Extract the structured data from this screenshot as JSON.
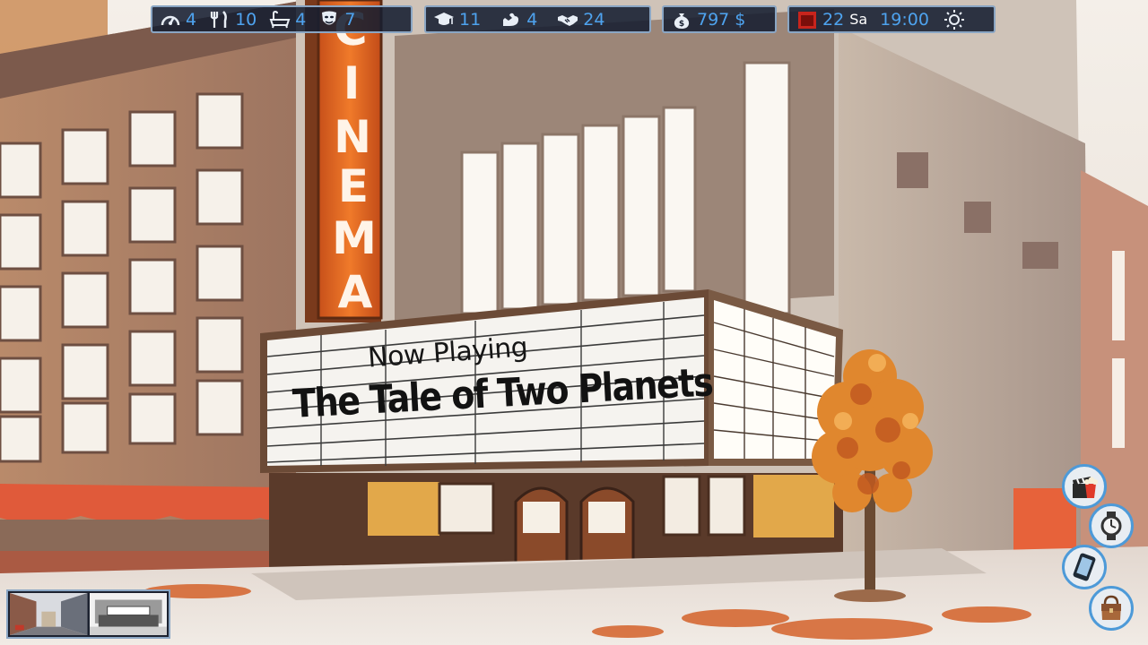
{
  "hud": {
    "stats_group1": [
      {
        "icon": "speedometer-icon",
        "value": "4"
      },
      {
        "icon": "fork-knife-icon",
        "value": "10"
      },
      {
        "icon": "bathtub-icon",
        "value": "4"
      },
      {
        "icon": "theater-mask-icon",
        "value": "7"
      }
    ],
    "stats_group2": [
      {
        "icon": "graduation-cap-icon",
        "value": "11"
      },
      {
        "icon": "flexed-arm-icon",
        "value": "4"
      },
      {
        "icon": "handshake-icon",
        "value": "24"
      }
    ],
    "money": {
      "icon": "money-bag-icon",
      "value": "797 $"
    },
    "date": {
      "icon": "calendar-icon",
      "day_number": "22",
      "weekday": "Sa",
      "time": "19:00",
      "weather_icon": "sun-icon"
    }
  },
  "scene": {
    "sign": "CINEMA",
    "marquee_line1": "Now Playing",
    "marquee_line2": "The Tale of Two Planets"
  },
  "side_buttons": [
    {
      "name": "cinema-action",
      "icon": "popcorn-clapperboard-icon"
    },
    {
      "name": "wait",
      "icon": "wristwatch-icon"
    },
    {
      "name": "phone",
      "icon": "smartphone-icon"
    },
    {
      "name": "inventory",
      "icon": "bag-icon"
    }
  ],
  "locations": [
    {
      "name": "street"
    },
    {
      "name": "cinema"
    }
  ],
  "colors": {
    "hud_text": "#4ea3ef",
    "hud_bg": "#161e30",
    "hud_border": "#8aa6c4",
    "sign_orange": "#e5661c"
  }
}
